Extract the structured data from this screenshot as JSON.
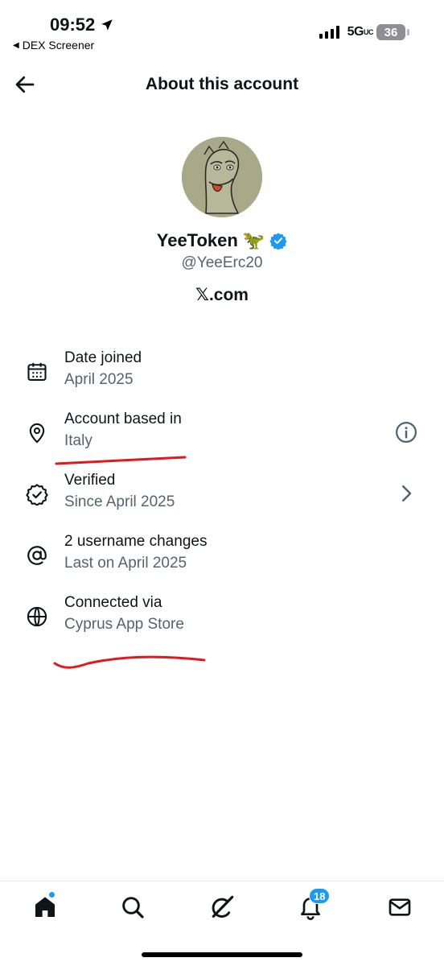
{
  "status_bar": {
    "time": "09:52",
    "back_app": "DEX Screener",
    "network": "5G",
    "network_suffix": "UC",
    "battery": "36"
  },
  "header": {
    "title": "About this account"
  },
  "profile": {
    "name": "YeeToken",
    "name_emoji": "🦖",
    "handle": "@YeeErc20",
    "site": "𝕏.com",
    "verified_color": "#1d9bf0"
  },
  "rows": [
    {
      "title": "Date joined",
      "sub": "April 2025",
      "icon": "calendar-icon"
    },
    {
      "title": "Account based in",
      "sub": "Italy",
      "icon": "location-pin-icon",
      "right_icon": "info-icon"
    },
    {
      "title": "Verified",
      "sub": "Since April 2025",
      "icon": "verified-badge-icon",
      "right_icon": "chevron-right-icon"
    },
    {
      "title": "2 username changes",
      "sub": "Last on April 2025",
      "icon": "at-sign-icon"
    },
    {
      "title": "Connected via",
      "sub": "Cyprus App Store",
      "icon": "globe-icon"
    }
  ],
  "tabbar": {
    "notifications_badge": "18",
    "items": [
      "home-icon",
      "search-icon",
      "grok-icon",
      "notifications-icon",
      "messages-icon"
    ]
  },
  "colors": {
    "text_primary": "#0f1419",
    "text_secondary": "#536471",
    "accent": "#1d9bf0",
    "annotation": "#e0191e"
  }
}
